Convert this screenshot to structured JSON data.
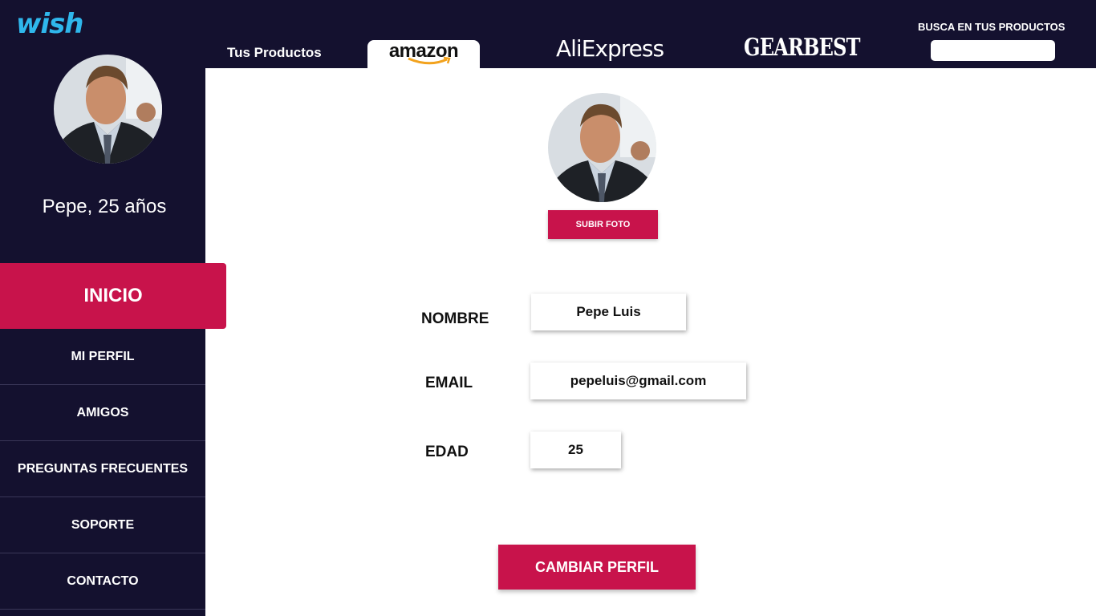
{
  "app": {
    "logo": "wish"
  },
  "user": {
    "name_age": "Pepe, 25 años"
  },
  "nav": {
    "items": [
      {
        "label": "INICIO",
        "active": true
      },
      {
        "label": "MI PERFIL"
      },
      {
        "label": "AMIGOS"
      },
      {
        "label": "PREGUNTAS FRECUENTES"
      },
      {
        "label": "SOPORTE"
      },
      {
        "label": "CONTACTO"
      }
    ]
  },
  "tabs": {
    "own": "Tus Productos",
    "amazon": "amazon",
    "aliexpress": "AliExpress",
    "gearbest": "GEARBEST"
  },
  "search": {
    "label": "BUSCA EN TUS PRODUCTOS",
    "value": ""
  },
  "profile": {
    "upload_label": "SUBIR FOTO",
    "name_label": "NOMBRE",
    "name_value": "Pepe Luis",
    "email_label": "EMAIL",
    "email_value": "pepeluis@gmail.com",
    "age_label": "EDAD",
    "age_value": "25",
    "submit_label": "CAMBIAR PERFIL"
  },
  "colors": {
    "sidebar": "#14112f",
    "accent": "#c8134b",
    "logo": "#2fb7ec"
  }
}
